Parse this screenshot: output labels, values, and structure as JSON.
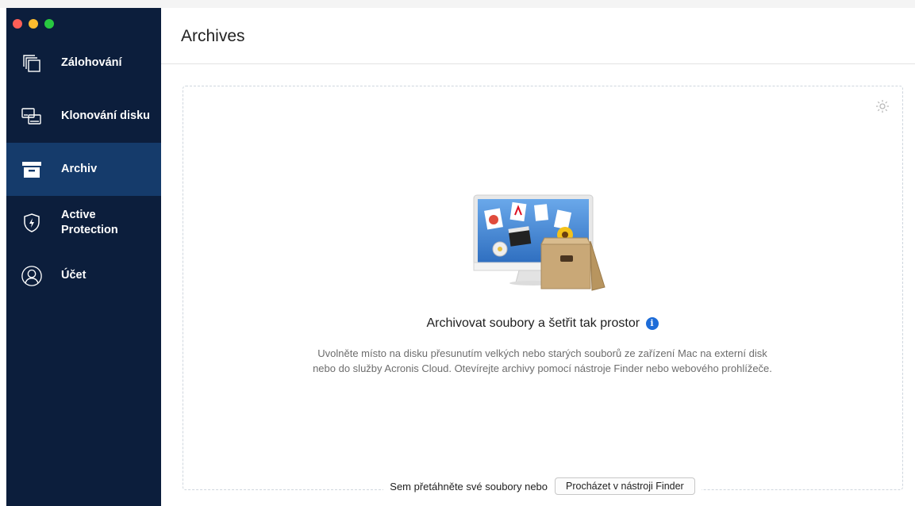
{
  "window": {
    "traffic_lights": [
      "#fe5f57",
      "#febc2e",
      "#28c840"
    ]
  },
  "sidebar": {
    "bg": "#0c1e3c",
    "active_bg": "#153b6b",
    "items": [
      {
        "label": "Zálohování",
        "icon": "backup-icon"
      },
      {
        "label": "Klonování disku",
        "icon": "disk-clone-icon"
      },
      {
        "label": "Archiv",
        "icon": "archive-icon",
        "active": true
      },
      {
        "label": "Active\nProtection",
        "icon": "shield-icon"
      },
      {
        "label": "Účet",
        "icon": "account-icon"
      }
    ]
  },
  "header": {
    "title": "Archives"
  },
  "main": {
    "heading": "Archivovat soubory a šetřit tak prostor",
    "info_icon": "i",
    "description_line1": "Uvolněte místo na disku přesunutím velkých nebo starých souborů ze zařízení Mac na externí disk",
    "description_line2": "nebo do služby Acronis Cloud. Otevírejte archivy pomocí nástroje Finder nebo webového prohlížeče.",
    "drag_text": "Sem přetáhněte své soubory nebo",
    "finder_button": "Procházet v nástroji Finder",
    "accent": "#1d6cd8"
  }
}
